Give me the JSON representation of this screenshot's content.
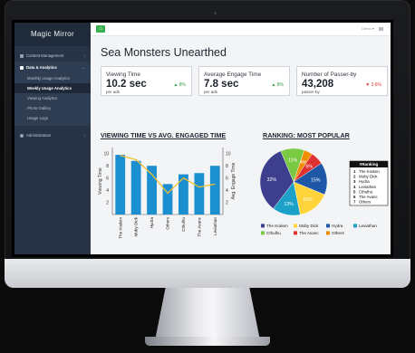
{
  "app": {
    "name": "Magic Mirror"
  },
  "sidebar": {
    "items": [
      {
        "label": "Content Management"
      },
      {
        "label": "Data & Analytics"
      },
      {
        "label": "Administration"
      }
    ],
    "sub_items": [
      {
        "label": "Monthly Usage Analytics"
      },
      {
        "label": "Weekly Usage Analytics"
      },
      {
        "label": "Viewing Analytics"
      },
      {
        "label": "Photo Gallery"
      },
      {
        "label": "Usage Logs"
      }
    ]
  },
  "topbar": {
    "user": "Demo"
  },
  "page": {
    "title": "Sea Monsters Unearthed"
  },
  "cards": [
    {
      "label": "Viewing Time",
      "value": "10.2 sec",
      "unit": "per ads",
      "change": "8%",
      "dir": "up"
    },
    {
      "label": "Average Engage Time",
      "value": "7.8 sec",
      "unit": "per ads",
      "change": "8%",
      "dir": "up"
    },
    {
      "label": "Number of Passer-by",
      "value": "43,208",
      "unit": "passer-by",
      "change": "3.6%",
      "dir": "down"
    }
  ],
  "sections": {
    "chart1": "VIEWING TIME VS AVG. ENGAGED TIME",
    "chart2": "RANKING: MOST POPULAR"
  },
  "chart_data": [
    {
      "type": "bar",
      "categories": [
        "The Kraken",
        "Moby Dick",
        "Hydra",
        "Others",
        "Cthulhu",
        "The Avanc",
        "Leviathan"
      ],
      "series": [
        {
          "name": "Viewing Time",
          "type": "bar",
          "values": [
            9.8,
            8.8,
            8.0,
            5.0,
            6.6,
            6.8,
            8.0
          ]
        },
        {
          "name": "Avg. Engage Time",
          "type": "line",
          "values": [
            9.7,
            9.0,
            6.6,
            3.5,
            6.0,
            4.5,
            5.0
          ]
        }
      ],
      "ylabel": "Viewing Time",
      "y2label": "Avg. Engage Time",
      "yticks": [
        2,
        4,
        6,
        8,
        10
      ],
      "ylim": [
        0,
        11
      ],
      "colors": {
        "bar": "#1b8fd0",
        "line": "#f2c12e"
      }
    },
    {
      "type": "pie",
      "slices": [
        {
          "name": "The Kraken",
          "value": 32,
          "label": "32%",
          "color": "#3d3f8e"
        },
        {
          "name": "Moby Dick",
          "value": 15,
          "label": "15%",
          "color": "#ffd43b"
        },
        {
          "name": "Hydra",
          "value": 15,
          "label": "15%",
          "color": "#1f57a8"
        },
        {
          "name": "Leviathan",
          "value": 13,
          "label": "13%",
          "color": "#1ba1c7"
        },
        {
          "name": "Cthulhu",
          "value": 11,
          "label": "11%",
          "color": "#7ac943"
        },
        {
          "name": "The Avanc",
          "value": 6,
          "label": "6%",
          "color": "#e03131"
        },
        {
          "name": "Others",
          "value": 4,
          "label": "4%",
          "color": "#f08c00"
        }
      ],
      "ranking": {
        "title": "#Ranking",
        "items": [
          {
            "rank": "1",
            "name": "The Kraken"
          },
          {
            "rank": "2",
            "name": "Moby Dick"
          },
          {
            "rank": "3",
            "name": "Hydra"
          },
          {
            "rank": "4",
            "name": "Leviathan"
          },
          {
            "rank": "5",
            "name": "Cthulhu"
          },
          {
            "rank": "6",
            "name": "The Avanc"
          },
          {
            "rank": "7",
            "name": "Others"
          }
        ]
      }
    }
  ]
}
